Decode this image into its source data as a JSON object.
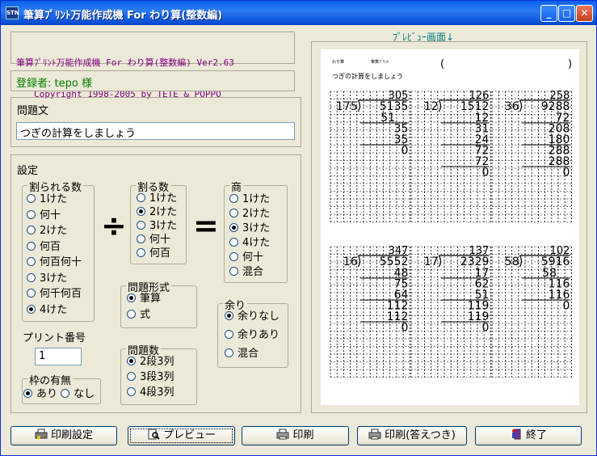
{
  "window": {
    "app_icon": "STN",
    "title": "筆算ﾌﾟﾘﾝﾄ万能作成機 For わり算(整数編)",
    "minimize": "_",
    "maximize": "□",
    "close": "✕"
  },
  "header": {
    "line1": "筆算ﾌﾟﾘﾝﾄ万能作成機 For わり算(整数編) Ver2.63",
    "line2": "Copyright 1998-2005 by TETE & POPPO"
  },
  "registration": "登録者: tepo 様",
  "problem_text": {
    "label": "問題文",
    "value": "つぎの計算をしましょう"
  },
  "settings": {
    "label": "設定",
    "dividend": {
      "title": "割られる数",
      "options": [
        "1けた",
        "何十",
        "2けた",
        "何百",
        "何百何十",
        "3けた",
        "何千何百",
        "4けた"
      ],
      "selected": 7
    },
    "divisor": {
      "title": "割る数",
      "options": [
        "1けた",
        "2けた",
        "3けた",
        "何十",
        "何百"
      ],
      "selected": 1
    },
    "quotient": {
      "title": "商",
      "options": [
        "1けた",
        "2けた",
        "3けた",
        "4けた",
        "何十",
        "混合"
      ],
      "selected": 2
    },
    "format": {
      "title": "問題形式",
      "options": [
        "筆算",
        "式"
      ],
      "selected": 0
    },
    "remainder": {
      "title": "余り",
      "options": [
        "余りなし",
        "余りあり",
        "混合"
      ],
      "selected": 0
    },
    "count": {
      "title": "問題数",
      "options": [
        "2段3列",
        "3段3列",
        "4段3列"
      ],
      "selected": 0
    },
    "frame": {
      "title": "枠の有無",
      "options": [
        "あり",
        "なし"
      ],
      "selected": 0
    },
    "print_number_label": "プリント番号",
    "print_number_value": "1",
    "divide_symbol": "÷",
    "equals_symbol": "="
  },
  "preview": {
    "label": "ﾌﾟﾚﾋﾞｭｰ画面↓",
    "small_label_1": "わり算",
    "small_label_2": "筆算ﾌﾟﾘﾝﾄ",
    "paren_open": "(",
    "paren_close": ")",
    "instruction": "つぎの計算をしましょう",
    "problems": [
      {
        "divisor": "175",
        "dividend": "5135",
        "quotient": "305",
        "steps": [
          "51",
          "35",
          "35",
          "0"
        ]
      },
      {
        "divisor": "12",
        "dividend": "1512",
        "quotient": "126",
        "steps": [
          "12",
          "31",
          "24",
          "72",
          "72",
          "0"
        ]
      },
      {
        "divisor": "36",
        "dividend": "9288",
        "quotient": "258",
        "steps": [
          "72",
          "208",
          "180",
          "288",
          "288",
          "0"
        ]
      },
      {
        "divisor": "16",
        "dividend": "5552",
        "quotient": "347",
        "steps": [
          "48",
          "75",
          "64",
          "112",
          "112",
          "0"
        ]
      },
      {
        "divisor": "17",
        "dividend": "2329",
        "quotient": "137",
        "steps": [
          "17",
          "62",
          "51",
          "119",
          "119",
          "0"
        ]
      },
      {
        "divisor": "58",
        "dividend": "5916",
        "quotient": "102",
        "steps": [
          "58",
          "116",
          "116",
          "0"
        ]
      }
    ]
  },
  "buttons": {
    "print_settings": "印刷設定",
    "preview": "プレビュー",
    "print": "印刷",
    "print_answers": "印刷(答えつき)",
    "exit": "終了"
  }
}
